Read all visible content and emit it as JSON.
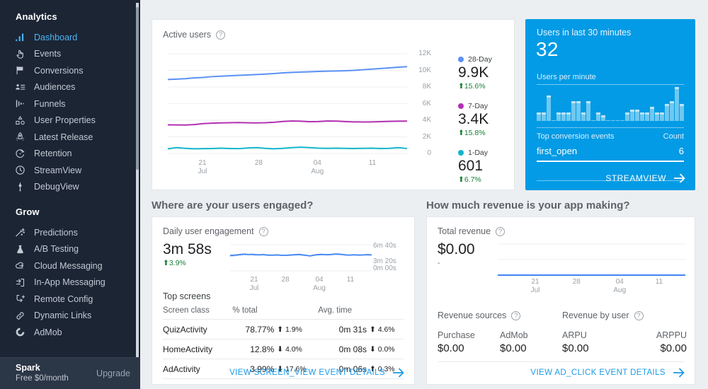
{
  "sidebar": {
    "analytics_title": "Analytics",
    "analytics_items": [
      {
        "label": "Dashboard",
        "icon": "bar-chart-icon",
        "active": true
      },
      {
        "label": "Events",
        "icon": "tap-hand-icon",
        "active": false
      },
      {
        "label": "Conversions",
        "icon": "flag-icon",
        "active": false
      },
      {
        "label": "Audiences",
        "icon": "audience-icon",
        "active": false
      },
      {
        "label": "Funnels",
        "icon": "funnel-icon",
        "active": false
      },
      {
        "label": "User Properties",
        "icon": "shapes-icon",
        "active": false
      },
      {
        "label": "Latest Release",
        "icon": "rocket-icon",
        "active": false
      },
      {
        "label": "Retention",
        "icon": "retention-arc-icon",
        "active": false
      },
      {
        "label": "StreamView",
        "icon": "clock-icon",
        "active": false
      },
      {
        "label": "DebugView",
        "icon": "debug-bug-icon",
        "active": false
      }
    ],
    "grow_title": "Grow",
    "grow_items": [
      {
        "label": "Predictions",
        "icon": "magic-wand-icon"
      },
      {
        "label": "A/B Testing",
        "icon": "flask-icon"
      },
      {
        "label": "Cloud Messaging",
        "icon": "cloud-icon"
      },
      {
        "label": "In-App Messaging",
        "icon": "in-app-message-icon"
      },
      {
        "label": "Remote Config",
        "icon": "remote-config-icon"
      },
      {
        "label": "Dynamic Links",
        "icon": "link-icon"
      },
      {
        "label": "AdMob",
        "icon": "admob-icon"
      }
    ],
    "footer": {
      "plan_name": "Spark",
      "plan_price": "Free $0/month",
      "upgrade_label": "Upgrade"
    }
  },
  "sections": {
    "engagement_heading": "Where are your users engaged?",
    "revenue_heading": "How much revenue is your app making?"
  },
  "active_users": {
    "title": "Active users",
    "help_glyph": "?",
    "legend": [
      {
        "name": "28-Day",
        "value": "9.9K",
        "delta": "15.6%",
        "direction": "up",
        "color": "#5b91f5"
      },
      {
        "name": "7-Day",
        "value": "3.4K",
        "delta": "15.8%",
        "direction": "up",
        "color": "#b430b4"
      },
      {
        "name": "1-Day",
        "value": "601",
        "delta": "6.7%",
        "direction": "up",
        "color": "#12b5cb"
      }
    ]
  },
  "realtime": {
    "title": "Users in last 30 minutes",
    "count": "32",
    "per_minute_label": "Users per minute",
    "table_header_event": "Top conversion events",
    "table_header_count": "Count",
    "rows": [
      {
        "event": "first_open",
        "count": "6"
      }
    ],
    "link_label": "STREAMVIEW"
  },
  "engagement": {
    "title": "Daily user engagement",
    "metric_value": "3m 58s",
    "metric_delta": "3.9%",
    "metric_direction": "up",
    "y_labels": [
      "6m 40s",
      "3m 20s",
      "0m 00s"
    ],
    "top_screens_title": "Top screens",
    "columns": [
      "Screen class",
      "% total",
      "Avg. time"
    ],
    "rows": [
      {
        "screen": "QuizActivity",
        "pct": "78.77%",
        "pct_delta": "1.9%",
        "pct_dir": "up",
        "time": "0m 31s",
        "time_delta": "4.6%",
        "time_dir": "up"
      },
      {
        "screen": "HomeActivity",
        "pct": "12.8%",
        "pct_delta": "4.0%",
        "pct_dir": "down",
        "time": "0m 08s",
        "time_delta": "0.0%",
        "time_dir": "down"
      },
      {
        "screen": "AdActivity",
        "pct": "3.99%",
        "pct_delta": "17.6%",
        "pct_dir": "down",
        "time": "0m 06s",
        "time_delta": "0.3%",
        "time_dir": "up"
      }
    ],
    "link_label": "VIEW SCREEN_VIEW EVENT DETAILS"
  },
  "revenue": {
    "title": "Total revenue",
    "metric_value": "$0.00",
    "metric_delta": "-",
    "sources_title": "Revenue sources",
    "by_user_title": "Revenue by user",
    "sources": [
      {
        "label": "Purchase",
        "value": "$0.00"
      },
      {
        "label": "AdMob",
        "value": "$0.00"
      }
    ],
    "by_user": [
      {
        "label": "ARPU",
        "value": "$0.00"
      },
      {
        "label": "ARPPU",
        "value": "$0.00"
      }
    ],
    "link_label": "VIEW AD_CLICK EVENT DETAILS"
  },
  "chart_data": [
    {
      "id": "active-users-chart",
      "type": "line",
      "title": "Active users",
      "xlabel": "",
      "ylabel": "",
      "ylim": [
        0,
        12000
      ],
      "yticks": [
        "0",
        "2K",
        "4K",
        "6K",
        "8K",
        "10K",
        "12K"
      ],
      "ytick_values": [
        0,
        2000,
        4000,
        6000,
        8000,
        10000,
        12000
      ],
      "xticks": [
        {
          "label": "21",
          "sublabel": "Jul"
        },
        {
          "label": "28",
          "sublabel": ""
        },
        {
          "label": "04",
          "sublabel": "Aug"
        },
        {
          "label": "11",
          "sublabel": ""
        }
      ],
      "grid": true,
      "legend_position": "right",
      "series": [
        {
          "name": "28-Day",
          "color": "#5b91f5",
          "values": [
            8900,
            8950,
            9000,
            9100,
            9150,
            9250,
            9300,
            9350,
            9400,
            9450,
            9500,
            9550,
            9620,
            9700,
            9760,
            9800,
            9830,
            9870,
            9900,
            9930,
            9960,
            10000,
            10080,
            10150,
            10220,
            10300,
            10380,
            10450
          ]
        },
        {
          "name": "7-Day",
          "color": "#b430b4",
          "values": [
            3450,
            3440,
            3430,
            3480,
            3600,
            3650,
            3680,
            3700,
            3720,
            3690,
            3680,
            3700,
            3760,
            3850,
            3900,
            3880,
            3820,
            3840,
            3900,
            3890,
            3840,
            3800,
            3790,
            3800,
            3830,
            3860,
            3880,
            3890
          ]
        },
        {
          "name": "1-Day",
          "color": "#12b5cb",
          "values": [
            560,
            700,
            620,
            560,
            580,
            600,
            640,
            600,
            580,
            660,
            700,
            620,
            560,
            620,
            700,
            760,
            700,
            640,
            620,
            640,
            620,
            600,
            620,
            640,
            600,
            620,
            700,
            601
          ]
        }
      ]
    },
    {
      "id": "users-per-minute-chart",
      "type": "bar",
      "title": "Users per minute",
      "categories": [
        "1",
        "2",
        "3",
        "4",
        "5",
        "6",
        "7",
        "8",
        "9",
        "10",
        "11",
        "12",
        "13",
        "14",
        "15",
        "16",
        "17",
        "18",
        "19",
        "20",
        "21",
        "22",
        "23",
        "24",
        "25",
        "26",
        "27",
        "28",
        "29",
        "30"
      ],
      "values": [
        3,
        3,
        9,
        0,
        3,
        3,
        3,
        7,
        7,
        3,
        7,
        0,
        3,
        2,
        0,
        0,
        0,
        0,
        3,
        4,
        4,
        3,
        3,
        5,
        3,
        3,
        6,
        7,
        12,
        6
      ],
      "ylim": [
        0,
        12
      ],
      "grid": false
    },
    {
      "id": "daily-engagement-sparkline",
      "type": "line",
      "title": "Daily user engagement",
      "ylim": [
        0,
        400
      ],
      "yticks": [
        "6m 40s",
        "3m 20s",
        "0m 00s"
      ],
      "ytick_values": [
        400,
        200,
        0
      ],
      "xticks": [
        {
          "label": "21",
          "sublabel": "Jul"
        },
        {
          "label": "28",
          "sublabel": ""
        },
        {
          "label": "04",
          "sublabel": "Aug"
        },
        {
          "label": "11",
          "sublabel": ""
        }
      ],
      "series": [
        {
          "name": "Current",
          "color": "#4285f4",
          "style": "solid",
          "values": [
            236,
            240,
            244,
            252,
            256,
            250,
            254,
            248,
            246,
            250,
            244,
            240,
            242,
            244,
            240,
            238,
            240,
            244,
            248,
            252,
            244,
            238,
            228,
            240,
            248,
            252,
            250,
            248,
            252,
            258,
            256,
            250,
            244,
            242,
            246,
            244,
            242,
            246,
            248,
            244
          ]
        },
        {
          "name": "Previous",
          "color": "#8ab4f8",
          "style": "dotted",
          "values": [
            222,
            226,
            234,
            240,
            246,
            244,
            240,
            238,
            236,
            240,
            236,
            234,
            236,
            238,
            236,
            234,
            236,
            238,
            240,
            242,
            236,
            232,
            226,
            234,
            240,
            244,
            242,
            240,
            244,
            248,
            246,
            242,
            238,
            236,
            240,
            238,
            236,
            240,
            242,
            240
          ]
        }
      ]
    },
    {
      "id": "total-revenue-chart",
      "type": "line",
      "title": "Total revenue",
      "ylim": [
        0,
        1
      ],
      "xticks": [
        {
          "label": "21",
          "sublabel": "Jul"
        },
        {
          "label": "28",
          "sublabel": ""
        },
        {
          "label": "04",
          "sublabel": "Aug"
        },
        {
          "label": "11",
          "sublabel": ""
        }
      ],
      "series": [
        {
          "name": "Revenue",
          "color": "#4285f4",
          "values": [
            0,
            0,
            0,
            0,
            0,
            0,
            0,
            0,
            0,
            0,
            0,
            0,
            0,
            0,
            0,
            0,
            0,
            0,
            0,
            0,
            0,
            0,
            0,
            0,
            0,
            0,
            0,
            0
          ]
        }
      ]
    }
  ]
}
